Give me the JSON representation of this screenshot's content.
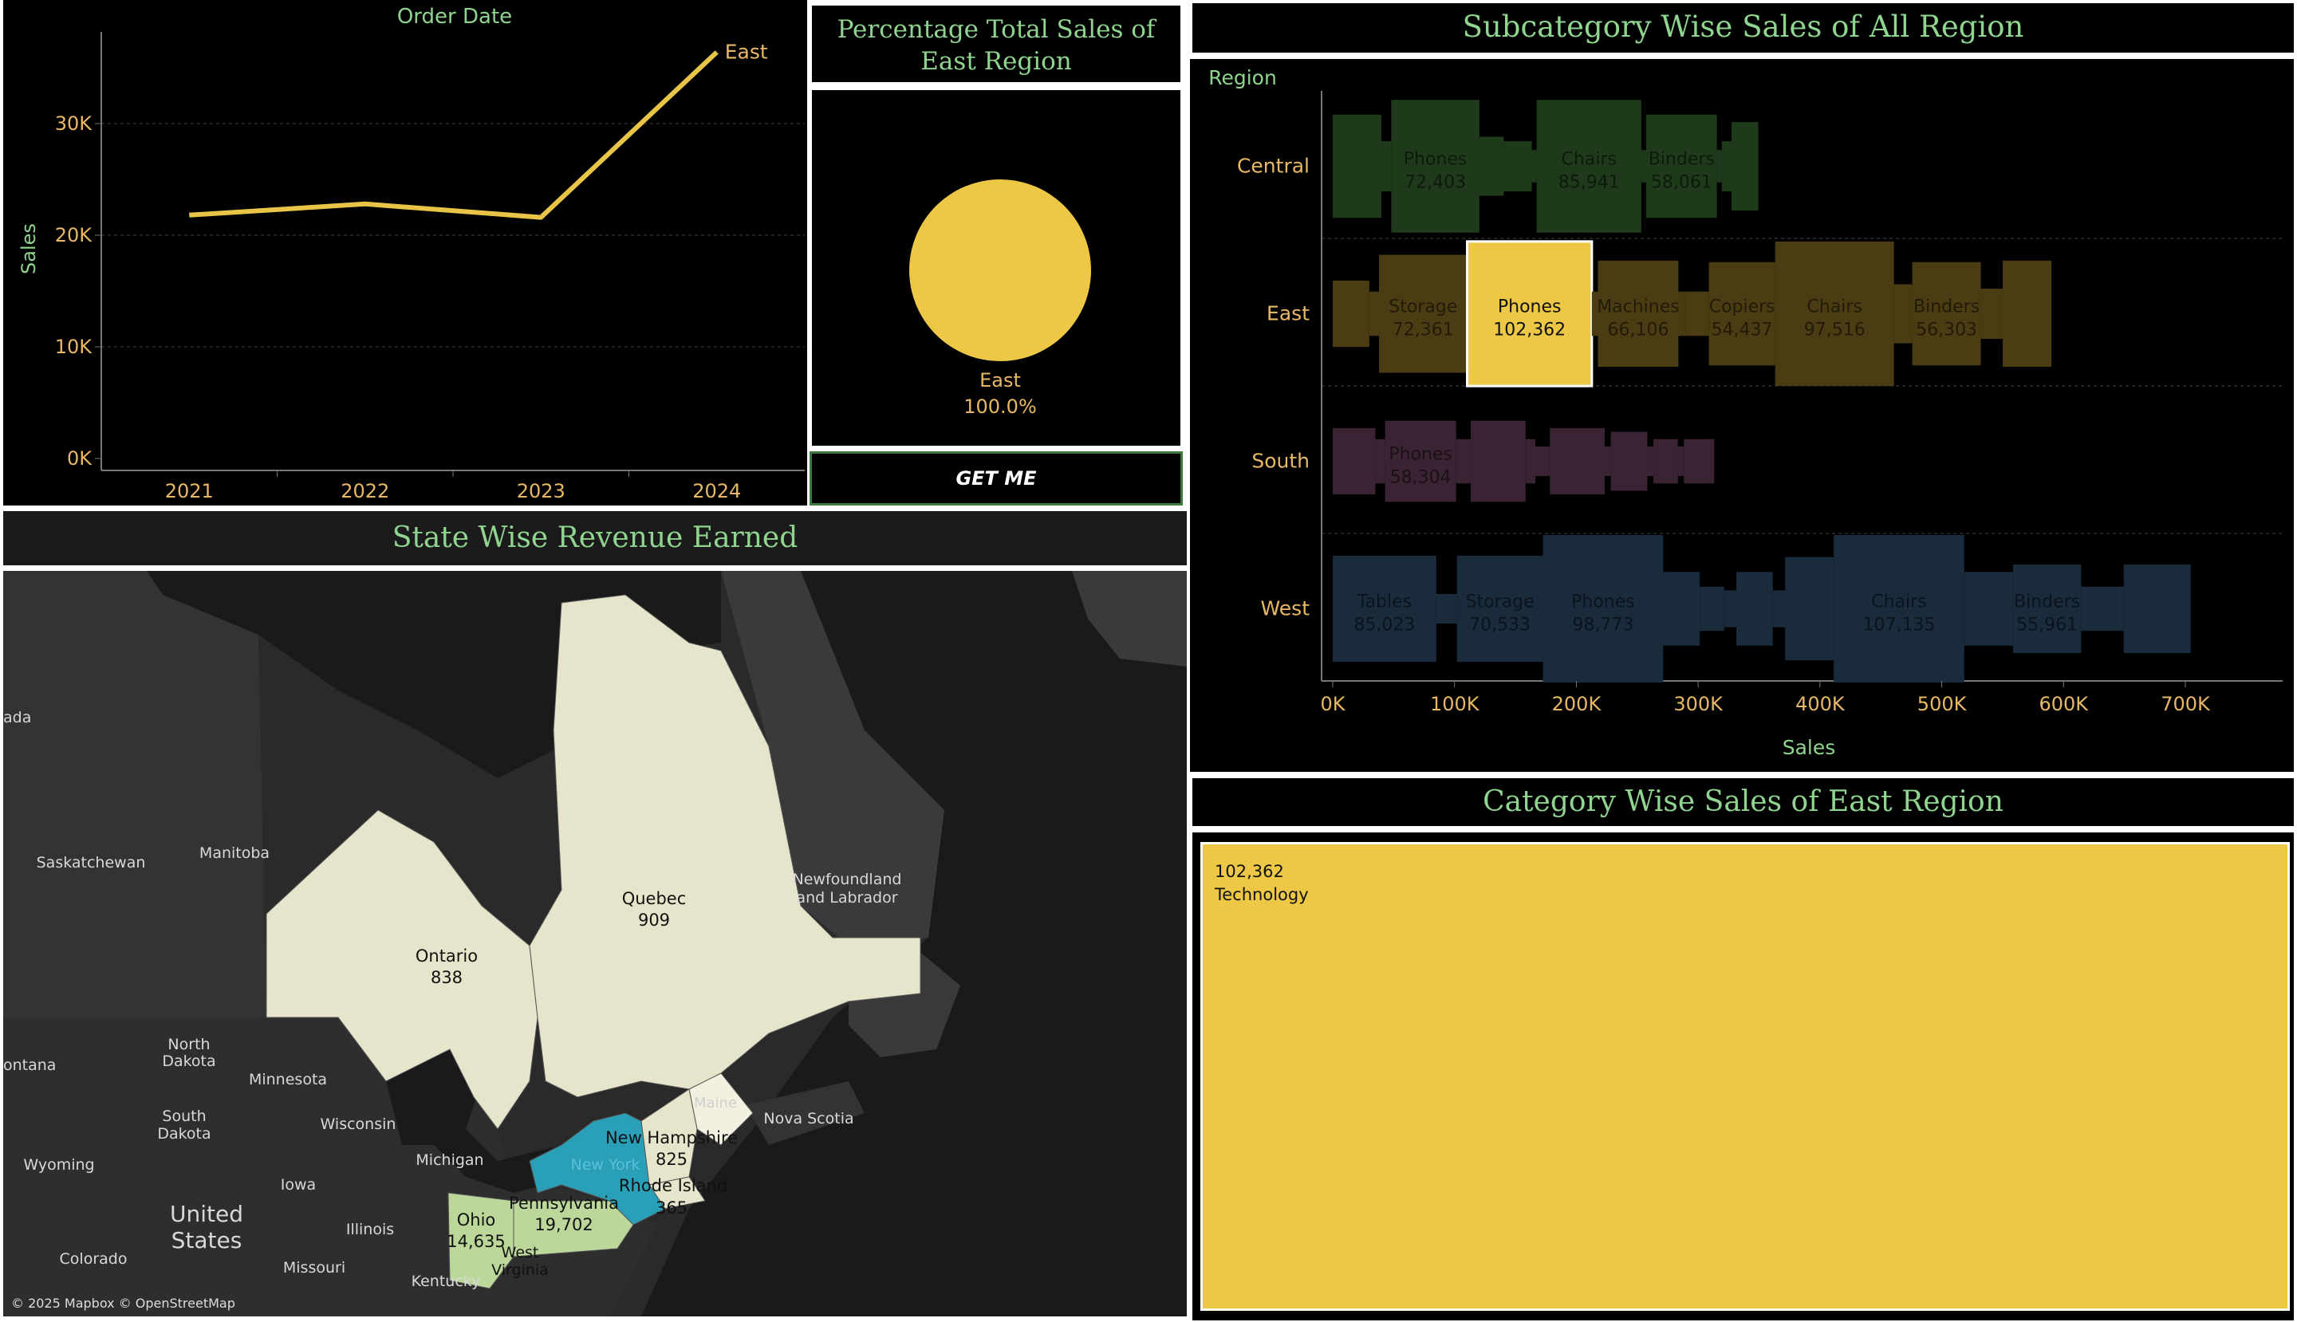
{
  "line_chart": {
    "header": "Order Date",
    "ylabel": "Sales",
    "series_label": "East",
    "color": "#e8c547",
    "y_ticks": [
      "0K",
      "10K",
      "20K",
      "30K"
    ],
    "x_ticks": [
      "2021",
      "2022",
      "2023",
      "2024"
    ],
    "chart_data": {
      "type": "line",
      "x": [
        "2021",
        "2022",
        "2023",
        "2024"
      ],
      "series": [
        {
          "name": "East",
          "values": [
            21800,
            22800,
            21600,
            36400
          ]
        }
      ],
      "xlabel": "Order Date",
      "ylabel": "Sales",
      "ylim": [
        0,
        40000
      ]
    }
  },
  "pie_panel": {
    "title": "Percentage Total Sales of East Region",
    "slice_label": "East",
    "slice_value": "100.0%",
    "color": "#ecc846",
    "chart_data": {
      "type": "pie",
      "categories": [
        "East"
      ],
      "values": [
        100.0
      ]
    }
  },
  "button": {
    "label": "GET ME"
  },
  "map_panel": {
    "title": "State Wise Revenue Earned",
    "attribution": "© 2025 Mapbox © OpenStreetMap",
    "regions": {
      "ontario": {
        "name": "Ontario",
        "value": "838"
      },
      "quebec": {
        "name": "Quebec",
        "value": "909"
      },
      "ohio": {
        "name": "Ohio",
        "value": "14,635"
      },
      "pennsylvania": {
        "name": "Pennsylvania",
        "value": "19,702"
      },
      "new_hampshire": {
        "name": "New Hampshire",
        "value": "825"
      },
      "rhode_island": {
        "name": "Rhode Island",
        "value": "365"
      },
      "new_york": {
        "name": "New York"
      },
      "maine": {
        "name": "Maine"
      }
    },
    "places": [
      "ada",
      "Saskatchewan",
      "Manitoba",
      "Newfoundland",
      "and Labrador",
      "ontana",
      "North",
      "Dakota",
      "Minnesota",
      "South",
      "Dakota",
      "Wyoming",
      "Wisconsin",
      "Michigan",
      "Iowa",
      "United",
      "States",
      "Illinois",
      "Colorado",
      "Missouri",
      "Kentucky",
      "West",
      "Virginia",
      "Nova Scotia"
    ]
  },
  "subcategory_panel": {
    "title": "Subcategory Wise Sales of All Region",
    "region_header": "Region",
    "xlabel": "Sales",
    "x_ticks": [
      "0K",
      "100K",
      "200K",
      "300K",
      "400K",
      "500K",
      "600K",
      "700K"
    ],
    "colors": {
      "Central": "#1f3a1b",
      "East": "#4a3c13",
      "South": "#3a2434",
      "West": "#1a2b3c",
      "highlight": "#ecc846"
    },
    "chart_data": {
      "type": "bar",
      "xlabel": "Sales",
      "ylabel": "Region",
      "xlim": [
        0,
        730000
      ],
      "rows": [
        {
          "region": "Central",
          "segments": [
            {
              "label": "",
              "value": 40000
            },
            {
              "label": "",
              "value": 8000
            },
            {
              "label": "Phones",
              "value": 72403,
              "text": "72,403"
            },
            {
              "label": "",
              "value": 20000
            },
            {
              "label": "",
              "value": 8000
            },
            {
              "label": "",
              "value": 15000
            },
            {
              "label": "",
              "value": 4000
            },
            {
              "label": "Chairs",
              "value": 85941,
              "text": "85,941"
            },
            {
              "label": "",
              "value": 4000
            },
            {
              "label": "Binders",
              "value": 58061,
              "text": "58,061"
            },
            {
              "label": "",
              "value": 4000
            },
            {
              "label": "",
              "value": 8000
            },
            {
              "label": "",
              "value": 22000
            }
          ]
        },
        {
          "region": "East",
          "segments": [
            {
              "label": "",
              "value": 30000
            },
            {
              "label": "",
              "value": 8000
            },
            {
              "label": "Storage",
              "value": 72361,
              "text": "72,361"
            },
            {
              "label": "Phones",
              "value": 102362,
              "text": "102,362"
            },
            {
              "label": "",
              "value": 5000
            },
            {
              "label": "Machines",
              "value": 66106,
              "text": "66,106"
            },
            {
              "label": "",
              "value": 5000
            },
            {
              "label": "",
              "value": 20000
            },
            {
              "label": "Copiers",
              "value": 54437,
              "text": "54,437"
            },
            {
              "label": "Chairs",
              "value": 97516,
              "text": "97,516"
            },
            {
              "label": "",
              "value": 15000
            },
            {
              "label": "Binders",
              "value": 56303,
              "text": "56,303"
            },
            {
              "label": "",
              "value": 18000
            },
            {
              "label": "",
              "value": 40000
            }
          ]
        },
        {
          "region": "South",
          "segments": [
            {
              "label": "",
              "value": 35000
            },
            {
              "label": "",
              "value": 8000
            },
            {
              "label": "Phones",
              "value": 58304,
              "text": "58,304"
            },
            {
              "label": "",
              "value": 12000
            },
            {
              "label": "",
              "value": 45000
            },
            {
              "label": "",
              "value": 8000
            },
            {
              "label": "",
              "value": 12000
            },
            {
              "label": "",
              "value": 45000
            },
            {
              "label": "",
              "value": 5000
            },
            {
              "label": "",
              "value": 30000
            },
            {
              "label": "",
              "value": 5000
            },
            {
              "label": "",
              "value": 20000
            },
            {
              "label": "",
              "value": 5000
            },
            {
              "label": "",
              "value": 25000
            }
          ]
        },
        {
          "region": "West",
          "segments": [
            {
              "label": "Tables",
              "value": 85023,
              "text": "85,023"
            },
            {
              "label": "",
              "value": 17000
            },
            {
              "label": "Storage",
              "value": 70533,
              "text": "70,533"
            },
            {
              "label": "Phones",
              "value": 98773,
              "text": "98,773"
            },
            {
              "label": "",
              "value": 30000
            },
            {
              "label": "",
              "value": 20000
            },
            {
              "label": "",
              "value": 10000
            },
            {
              "label": "",
              "value": 30000
            },
            {
              "label": "",
              "value": 10000
            },
            {
              "label": "",
              "value": 40000
            },
            {
              "label": "Chairs",
              "value": 107135,
              "text": "107,135"
            },
            {
              "label": "",
              "value": 40000
            },
            {
              "label": "Binders",
              "value": 55961,
              "text": "55,961"
            },
            {
              "label": "",
              "value": 35000
            },
            {
              "label": "",
              "value": 55000
            }
          ]
        }
      ]
    }
  },
  "category_panel": {
    "title": "Category Wise Sales of East Region",
    "value": "102,362",
    "category": "Technology",
    "color": "#ecc846",
    "chart_data": {
      "type": "bar",
      "categories": [
        "Technology"
      ],
      "values": [
        102362
      ]
    }
  }
}
